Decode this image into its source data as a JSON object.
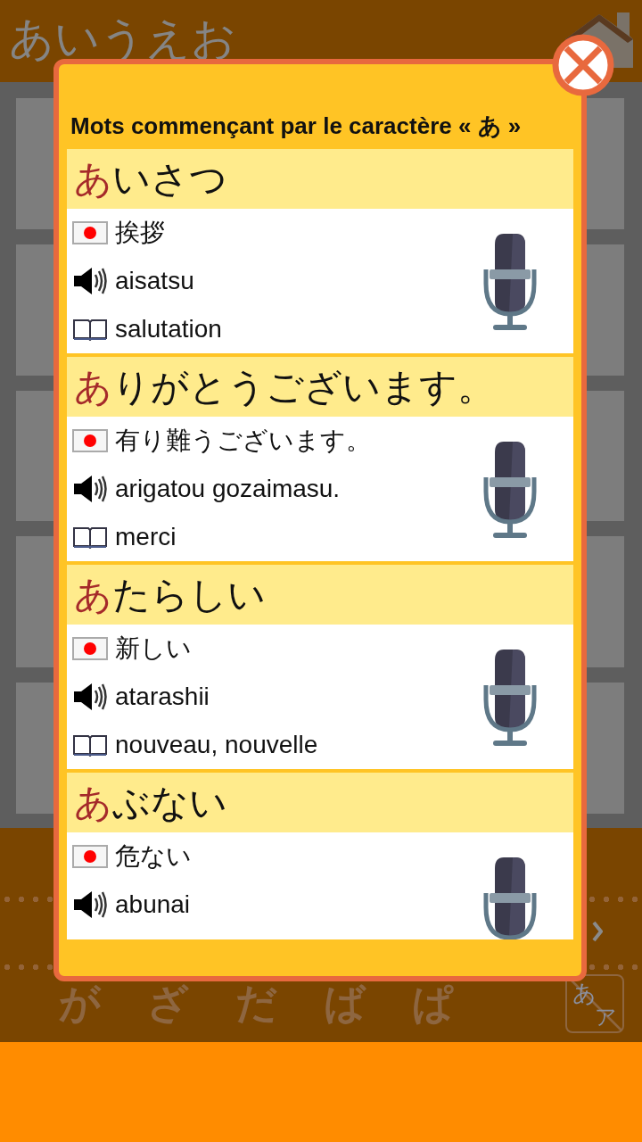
{
  "header": {
    "title": "あいうえお"
  },
  "dialog": {
    "title": "Mots commençant par le caractère « あ »",
    "entries": [
      {
        "initial": "あ",
        "rest": "いさつ",
        "kanji": "挨拶",
        "romaji": "aisatsu",
        "meaning": "salutation"
      },
      {
        "initial": "あ",
        "rest": "りがとうございます。",
        "kanji": "有り難うございます。",
        "romaji": "arigatou gozaimasu.",
        "meaning": "merci"
      },
      {
        "initial": "あ",
        "rest": "たらしい",
        "kanji": "新しい",
        "romaji": "atarashii",
        "meaning": "nouveau, nouvelle"
      },
      {
        "initial": "あ",
        "rest": "ぶない",
        "kanji": "危ない",
        "romaji": "abunai"
      }
    ]
  },
  "kana_row": [
    "が",
    "ざ",
    "だ",
    "ば",
    "ぱ"
  ],
  "script_toggle": {
    "hiragana": "あ",
    "katakana": "ア"
  }
}
